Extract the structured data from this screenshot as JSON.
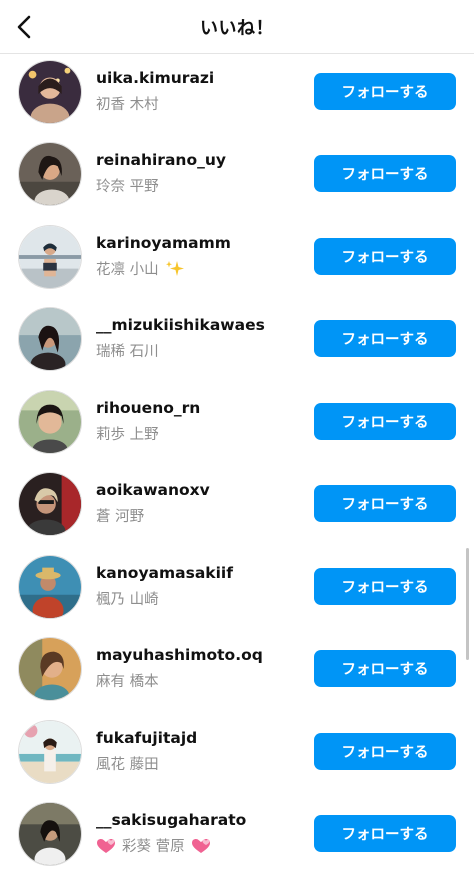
{
  "header": {
    "title": "いいね！"
  },
  "follow_label": "フォローする",
  "colors": {
    "accent": "#0095f6"
  },
  "users": [
    {
      "username": "uika.kimurazi",
      "fullname": "初香 木村"
    },
    {
      "username": "reinahirano_uy",
      "fullname": "玲奈 平野"
    },
    {
      "username": "karinoyamamm",
      "fullname": "花凛 小山"
    },
    {
      "username": "__mizukiishikawaes",
      "fullname": "瑞稀 石川"
    },
    {
      "username": "rihoueno_rn",
      "fullname": "莉歩 上野"
    },
    {
      "username": "aoikawanoxv",
      "fullname": "蒼 河野"
    },
    {
      "username": "kanoyamasakiif",
      "fullname": "楓乃 山崎"
    },
    {
      "username": "mayuhashimoto.oq",
      "fullname": "麻有 橋本"
    },
    {
      "username": "fukafujitajd",
      "fullname": "風花 藤田"
    },
    {
      "username": "__sakisugaharato",
      "fullname": "彩葵 菅原"
    }
  ]
}
